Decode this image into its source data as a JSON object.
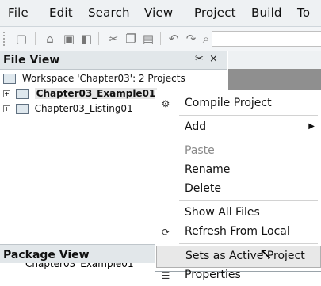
{
  "menubar": {
    "items": [
      "File",
      "Edit",
      "Search",
      "View",
      "Project",
      "Build",
      "To"
    ]
  },
  "toolbar": {
    "icons": [
      "new-file-icon",
      "open-folder-icon",
      "save-icon",
      "save-all-icon",
      "cut-icon",
      "copy-icon",
      "paste-icon",
      "undo-icon",
      "redo-icon",
      "find-icon"
    ]
  },
  "file_view": {
    "title": "File View",
    "pin_glyph": "✂",
    "close_glyph": "×",
    "workspace_label": "Workspace 'Chapter03': 2 Projects",
    "projects": [
      "Chapter03_Example01",
      "Chapter03_Listing01"
    ]
  },
  "context_menu": {
    "items": [
      {
        "label": "Compile Project"
      },
      {
        "label": "Add"
      },
      {
        "label": "Paste"
      },
      {
        "label": "Rename"
      },
      {
        "label": "Delete"
      },
      {
        "label": "Show All Files"
      },
      {
        "label": "Refresh From Local"
      },
      {
        "label": "Sets as Active Project"
      },
      {
        "label": "Properties"
      }
    ]
  },
  "package_view": {
    "title": "Package View",
    "first_row": "Chapter03_Example01"
  }
}
